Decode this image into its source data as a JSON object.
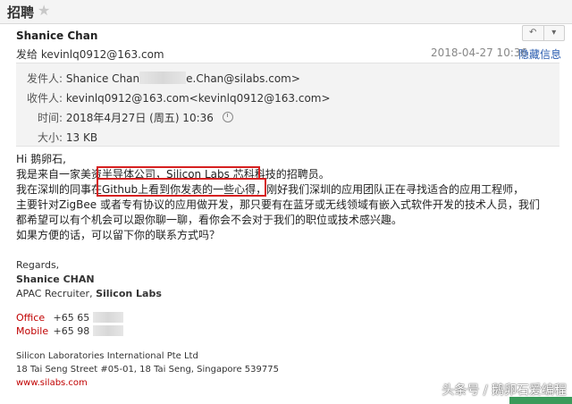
{
  "header": {
    "title": "招聘",
    "star_icon": "star-icon"
  },
  "message": {
    "sender_name": "Shanice Chan",
    "send_to": "发给 kevinlq0912@163.com",
    "date": "2018-04-27 10:36",
    "hide_info": "隐藏信息",
    "reply_label": "↶",
    "more_label": "▾"
  },
  "details": {
    "from_label": "发件人:",
    "from_value_a": "Shanice Chan",
    "from_value_b": "e.Chan@silabs.com>",
    "to_label": "收件人:",
    "to_value": "kevinlq0912@163.com<kevinlq0912@163.com>",
    "time_label": "时间:",
    "time_value": "2018年4月27日 (周五) 10:36",
    "size_label": "大小:",
    "size_value": "13 KB"
  },
  "body": {
    "line1": "Hi 鹅卵石,",
    "line2": "我是来自一家美资半导体公司，Silicon Labs 芯科科技的招聘员。",
    "line3": "我在深圳的同事在Github上看到你发表的一些心得，刚好我们深圳的应用团队正在寻找适合的应用工程师，",
    "line4": "主要针对ZigBee 或者专有协议的应用做开发，那只要有在蓝牙或无线领域有嵌入式软件开发的技术人员，我们",
    "line5": "都希望可以有个机会可以跟你聊一聊，看你会不会对于我们的职位或技术感兴趣。",
    "line6": "如果方便的话，可以留下你的联系方式吗？"
  },
  "signature": {
    "regards": "Regards,",
    "name": "Shanice CHAN",
    "role": "APAC Recruiter,",
    "company": "Silicon Labs",
    "office_label": "Office",
    "office_value": "+65 65",
    "mobile_label": "Mobile",
    "mobile_value": "+65 98",
    "address1": "Silicon Laboratories International Pte Ltd",
    "address2": "18 Tai Seng Street #05-01, 18 Tai Seng, Singapore 539775",
    "website": "www.silabs.com"
  },
  "watermark": "头条号 / 鹅卵石爱编程",
  "colors": {
    "highlight_box": "#d62020",
    "link": "#2a5db0",
    "signature_red": "#c00000"
  }
}
